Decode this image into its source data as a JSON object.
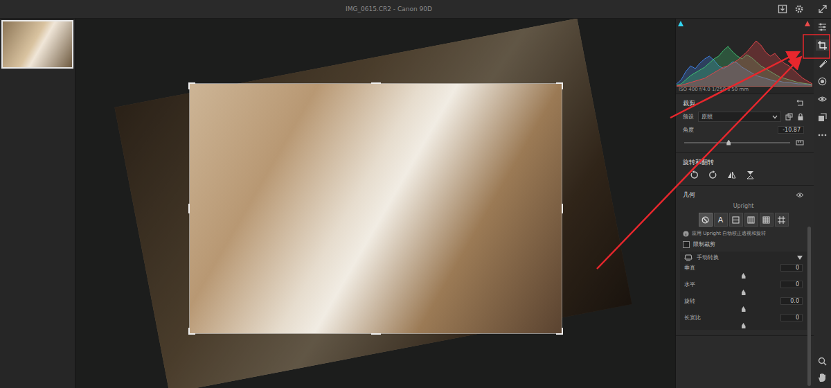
{
  "window": {
    "title": "IMG_0615.CR2 - Canon 90D"
  },
  "filmstrip": [
    {
      "selected": true
    }
  ],
  "histogram": {
    "readout": "ISO 400   f/4.0   1/250 s   50 mm",
    "series": [
      {
        "name": "blue",
        "color": "#3f7fe0",
        "values": [
          4,
          10,
          22,
          30,
          26,
          34,
          40,
          44,
          38,
          30,
          26,
          30,
          36,
          34,
          28,
          24,
          20,
          16,
          14,
          12,
          10,
          8,
          8,
          6,
          6,
          5,
          4,
          4,
          3,
          2
        ]
      },
      {
        "name": "green",
        "color": "#3fc070",
        "values": [
          2,
          4,
          10,
          16,
          20,
          24,
          28,
          34,
          40,
          44,
          52,
          58,
          50,
          44,
          40,
          46,
          42,
          36,
          30,
          26,
          22,
          18,
          14,
          12,
          10,
          8,
          6,
          5,
          4,
          3
        ]
      },
      {
        "name": "red",
        "color": "#e0454a",
        "values": [
          1,
          2,
          4,
          6,
          8,
          10,
          12,
          16,
          20,
          24,
          28,
          30,
          34,
          38,
          44,
          50,
          58,
          66,
          60,
          50,
          44,
          48,
          40,
          34,
          30,
          24,
          18,
          12,
          8,
          4
        ]
      }
    ]
  },
  "tools": [
    {
      "kind": "edit",
      "selected": false
    },
    {
      "kind": "crop",
      "selected": true
    },
    {
      "kind": "heal",
      "selected": false
    },
    {
      "kind": "mask",
      "selected": false
    },
    {
      "kind": "redeye",
      "selected": false
    },
    {
      "kind": "presets",
      "selected": false
    },
    {
      "kind": "more",
      "selected": false
    }
  ],
  "crop": {
    "title": "裁剪",
    "preset_label": "预设",
    "preset_value": "原照",
    "locked": true,
    "angle_label": "角度",
    "angle_value": "-10.87",
    "angle_level": 0.42
  },
  "rotate": {
    "title": "旋转和翻转"
  },
  "geometry": {
    "title": "几何",
    "visible": true,
    "upright_label": "Upright",
    "upright_modes": [
      {
        "kind": "off",
        "label": "",
        "selected": true
      },
      {
        "kind": "auto",
        "label": "A",
        "selected": false
      },
      {
        "kind": "level",
        "label": "",
        "selected": false
      },
      {
        "kind": "vertical",
        "label": "",
        "selected": false
      },
      {
        "kind": "full",
        "label": "",
        "selected": false
      },
      {
        "kind": "guided",
        "label": "",
        "selected": false
      }
    ],
    "info": "应用 Upright 自动校正透视和旋转",
    "constrain": {
      "label": "限制裁剪",
      "checked": false
    },
    "manual": {
      "title": "手动转换",
      "expanded": true
    },
    "sliders": [
      {
        "label": "垂直",
        "value": "0",
        "level": 0.5
      },
      {
        "label": "水平",
        "value": "0",
        "level": 0.5
      },
      {
        "label": "旋转",
        "value": "0.0",
        "level": 0.5
      },
      {
        "label": "长宽比",
        "value": "0",
        "level": 0.5
      }
    ]
  }
}
